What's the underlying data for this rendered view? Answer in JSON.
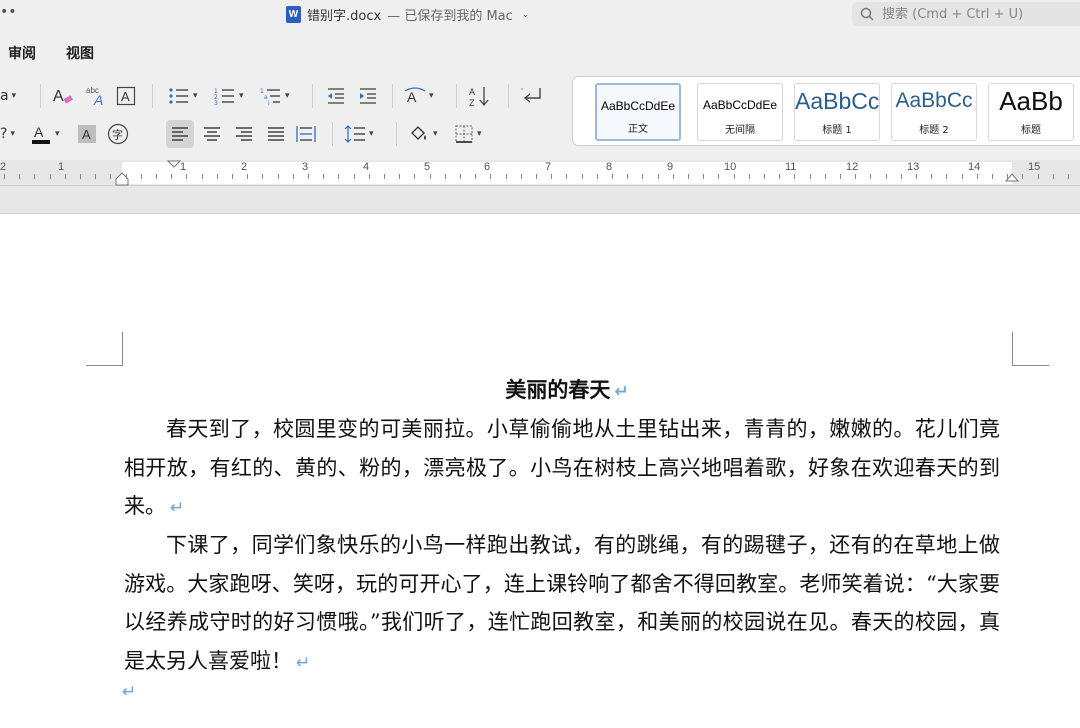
{
  "window": {
    "title": "错别字.docx",
    "status": "— 已保存到我的 Mac",
    "search_placeholder": "搜索 (Cmd + Ctrl + U)"
  },
  "ribbon_tabs": [
    "审阅",
    "视图"
  ],
  "styles": [
    {
      "sample": "AaBbCcDdEe",
      "name": "正文"
    },
    {
      "sample": "AaBbCcDdEe",
      "name": "无间隔"
    },
    {
      "sample": "AaBbCc",
      "name": "标题 1"
    },
    {
      "sample": "AaBbCc",
      "name": "标题 2"
    },
    {
      "sample": "AaBb",
      "name": "标题"
    }
  ],
  "ruler_numbers": [
    "2",
    "1",
    "1",
    "2",
    "3",
    "4",
    "5",
    "6",
    "7",
    "8",
    "9",
    "10",
    "11",
    "12",
    "13",
    "14",
    "15"
  ],
  "document": {
    "title": "美丽的春天",
    "paragraphs": [
      "春天到了，校圆里变的可美丽拉。小草偷偷地从土里钻出来，青青的，嫩嫩的。花儿们竟相开放，有红的、黄的、粉的，漂亮极了。小鸟在树枝上高兴地唱着歌，好象在欢迎春天的到来。",
      "下课了，同学们象快乐的小鸟一样跑出教试，有的跳绳，有的踢毽子，还有的在草地上做游戏。大家跑呀、笑呀，玩的可开心了，连上课铃响了都舍不得回教室。老师笑着说：“大家要以经养成守时的好习惯哦。”我们听了，连忙跑回教室，和美丽的校园说在见。春天的校园，真是太另人喜爱啦！"
    ],
    "paragraph_mark": "↵"
  },
  "icons": {
    "word_app_icon": "W"
  }
}
